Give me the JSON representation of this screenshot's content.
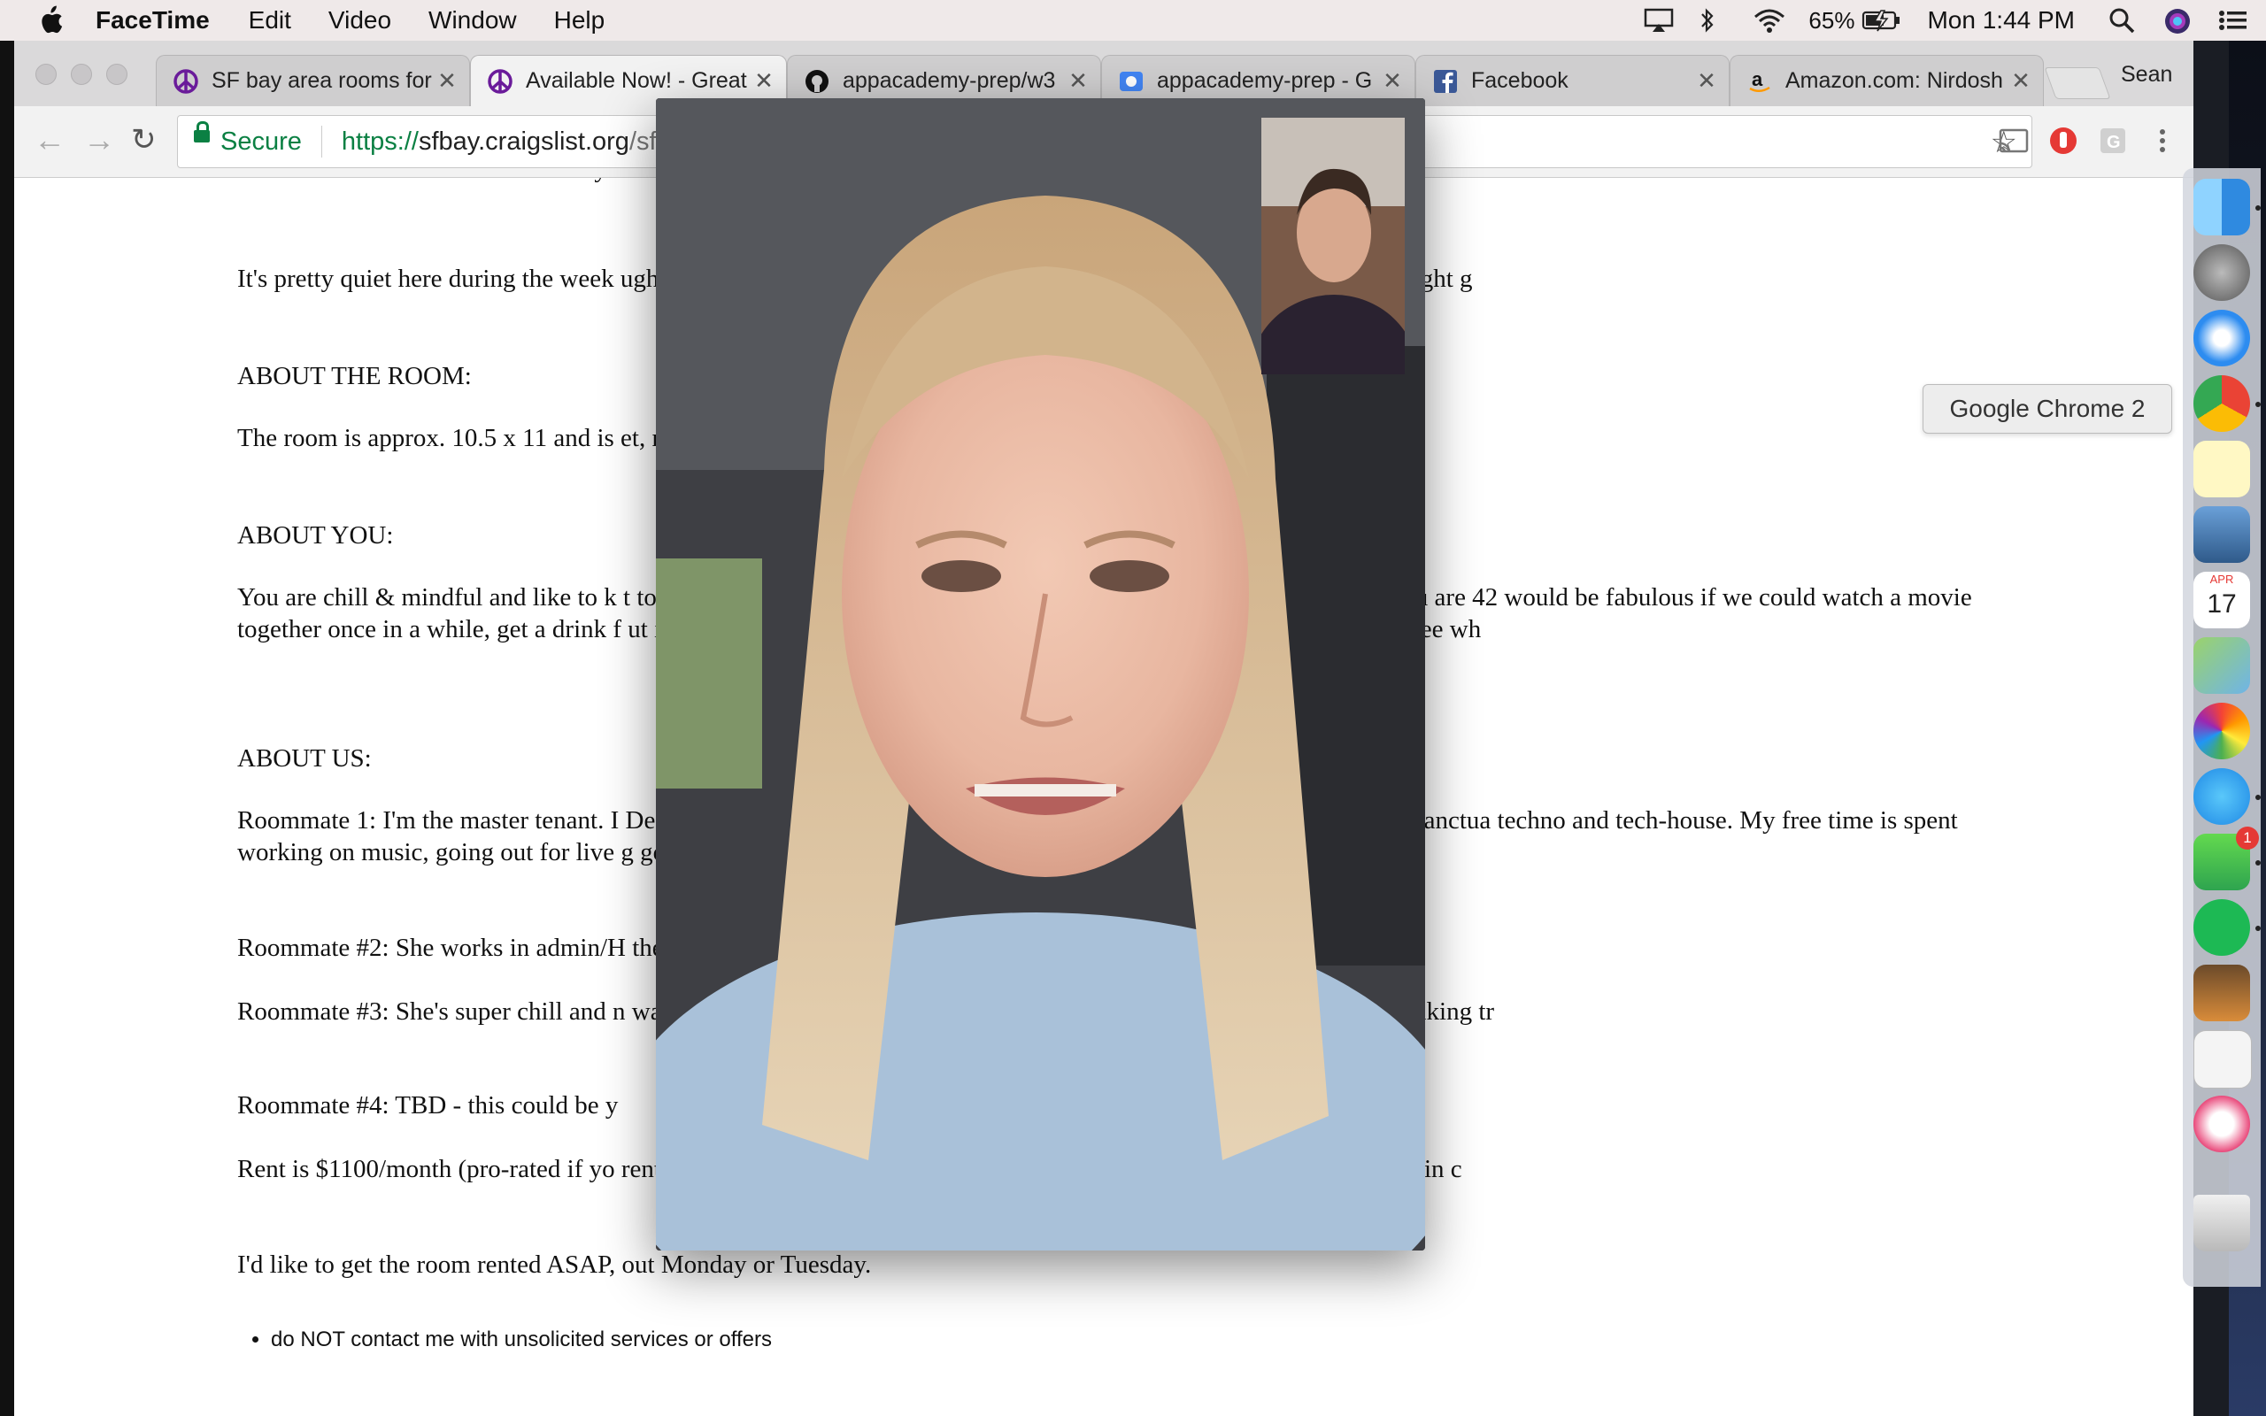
{
  "menubar": {
    "app_name": "FaceTime",
    "menus": [
      "Edit",
      "Video",
      "Window",
      "Help"
    ],
    "battery": "65%",
    "clock": "Mon 1:44 PM"
  },
  "browser": {
    "tabs": [
      {
        "title": "SF bay area rooms for",
        "icon": "peace-icon"
      },
      {
        "title": "Available Now! - Great",
        "icon": "peace-icon"
      },
      {
        "title": "appacademy-prep/w3",
        "icon": "github-icon"
      },
      {
        "title": "appacademy-prep - G",
        "icon": "drive-icon"
      },
      {
        "title": "Facebook",
        "icon": "facebook-icon"
      },
      {
        "title": "Amazon.com: Nirdosh",
        "icon": "amazon-icon"
      }
    ],
    "profile": "Sean",
    "secure_label": "Secure",
    "url_scheme": "https://",
    "url_host": "sfbay.craigslist.org",
    "url_rest": "/sf"
  },
  "page": {
    "paragraphs": [
      "Comcast Wireless Internet normally c",
      "It's pretty quiet here during the week                                                                                ughter are welcome and encouraged, but this really isn't a party house. Overnight g",
      "ABOUT THE ROOM:",
      "The room is approx. 10.5 x 11 and is                                                                                   et, nice scenery outside, and.... a sink/vanity area!",
      "ABOUT YOU:",
      "You are chill & mindful and like to k                                                                                   t to have a friendly household and are not anal, judgmental, or anti-social. You are 42                                                                                  would be fabulous if we could watch a movie together once in a while, get a drink f                                                                                 ut it doesn't really matter. Let's just get along, appreciate what we have, and see wh",
      "ABOUT US:",
      "Roommate 1: I'm the master tenant. I                                                                                     Design portfolio. I stay pretty busy in general, so I love that my house is my sanctua                                                                               techno and tech-house. My free time is spent working on music, going out for live                                                                                 g good food with people who make me laugh.",
      "Roommate #2: She works in admin/H                                                                                           the most part, but she's very nice, too!",
      "Roommate #3: She's super chill and n                                                                                    was working for doing customer relations laid off half the staff. She enjoys taking tr",
      "Roommate #4: TBD - this could be y",
      "Rent is $1100/month (pro-rated if yo                                                                                   rent + $750 security deposit (total deposit is $1850). For example, total move-in c",
      "I'd like to get the room rented ASAP,                                                                                    out Monday or Tuesday."
    ],
    "bullets": [
      "do NOT contact me with unsolicited services or offers"
    ]
  },
  "dock": {
    "tooltip": "Google Chrome 2",
    "calendar_month": "APR",
    "calendar_day": "17",
    "facetime_badge": "1",
    "items": [
      "finder-icon",
      "system-preferences-icon",
      "safari-icon",
      "chrome-icon",
      "notes-icon",
      "preview-icon",
      "calendar-icon",
      "maps-icon",
      "photos-icon",
      "messages-icon",
      "facetime-icon",
      "spotify-icon",
      "garageband-icon",
      "textedit-icon",
      "itunes-icon",
      "trash-icon"
    ]
  }
}
